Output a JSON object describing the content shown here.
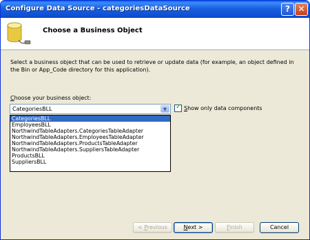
{
  "window": {
    "title": "Configure Data Source - categoriesDataSource"
  },
  "header": {
    "title": "Choose a Business Object"
  },
  "description": "Select a business object that can be used to retrieve or update data (for example, an object defined in the Bin or App_Code directory for this application).",
  "chooser": {
    "label_first": "C",
    "label_rest": "hoose your business object:",
    "selected": "CategoriesBLL",
    "options": [
      "CategoriesBLL",
      "EmployeesBLL",
      "NorthwindTableAdapters.CategoriesTableAdapter",
      "NorthwindTableAdapters.EmployeesTableAdapter",
      "NorthwindTableAdapters.ProductsTableAdapter",
      "NorthwindTableAdapters.SuppliersTableAdapter",
      "ProductsBLL",
      "SuppliersBLL"
    ],
    "highlighted_index": 0
  },
  "show_only_data_components": {
    "checked": true,
    "label_first": "S",
    "label_rest": "how only data components"
  },
  "buttons": {
    "previous": {
      "prefix": "< ",
      "mnemonic": "P",
      "rest": "revious",
      "enabled": false
    },
    "next": {
      "mnemonic": "N",
      "rest": "ext >",
      "enabled": true
    },
    "finish": {
      "mnemonic": "F",
      "rest": "inish",
      "enabled": false
    },
    "cancel": {
      "label": "Cancel",
      "enabled": true
    }
  },
  "colors": {
    "titlebar": "#0a5be0",
    "selection": "#316ac5",
    "dialog_bg": "#ece9d8"
  }
}
